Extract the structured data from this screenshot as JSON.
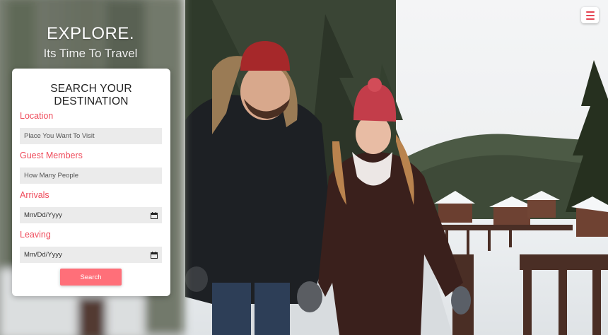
{
  "hero": {
    "title": "EXPLORE.",
    "subtitle": "Its Time To Travel"
  },
  "search_card": {
    "heading": "SEARCH YOUR DESTINATION",
    "fields": [
      {
        "label": "Location",
        "placeholder": "Place You Want To Visit"
      },
      {
        "label": "Guest Members",
        "placeholder": "How Many People"
      },
      {
        "label": "Arrivals",
        "value": "Mm/Dd/Yyyy"
      },
      {
        "label": "Leaving",
        "value": "Mm/Dd/Yyyy"
      }
    ],
    "search_button": "Search"
  },
  "menu": {
    "icon": "hamburger-menu-icon"
  },
  "colors": {
    "accent": "#ef4a5a",
    "button": "#ff6f79",
    "field_bg": "#ebebeb"
  }
}
